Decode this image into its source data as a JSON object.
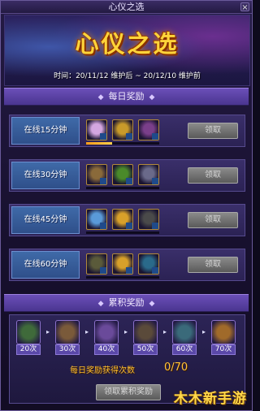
{
  "window": {
    "title": "心仪之选",
    "close_label": "×"
  },
  "banner": {
    "title": "心仪之选",
    "time": "时间：20/11/12 维护后 ~ 20/12/10 维护前"
  },
  "daily": {
    "header": "每日奖励",
    "header_ornament": "◆",
    "rows": [
      {
        "label": "在线15分钟",
        "button": "领取",
        "progress": 0.35,
        "items": [
          {
            "icon": "pink-crystal-icon",
            "color": "#d4a6e0"
          },
          {
            "icon": "gold-medal-icon",
            "color": "#c89a2a"
          },
          {
            "icon": "purple-chest-icon",
            "color": "#7a3f8a"
          }
        ]
      },
      {
        "label": "在线30分钟",
        "button": "领取",
        "progress": 0,
        "items": [
          {
            "icon": "wooden-box-icon",
            "color": "#8a6a3a"
          },
          {
            "icon": "green-ticket-icon",
            "color": "#4a8a2a"
          },
          {
            "icon": "silver-frame-icon",
            "color": "#6a6a8a"
          }
        ]
      },
      {
        "label": "在线45分钟",
        "button": "领取",
        "progress": 0,
        "items": [
          {
            "icon": "blue-crystal-icon",
            "color": "#5a9ad8"
          },
          {
            "icon": "gold-box-icon",
            "color": "#d8a02a"
          },
          {
            "icon": "dark-cube-icon",
            "color": "#4a4a4a"
          }
        ]
      },
      {
        "label": "在线60分钟",
        "button": "领取",
        "progress": 0,
        "items": [
          {
            "icon": "scroll-icon",
            "color": "#5a5a3a"
          },
          {
            "icon": "gold-chest-icon",
            "color": "#d8a02a"
          },
          {
            "icon": "blue-pet-icon",
            "color": "#2a6a8a"
          }
        ]
      }
    ]
  },
  "accumulated": {
    "header": "累积奖励",
    "header_ornament": "◆",
    "arrow": "▸",
    "tiers": [
      {
        "label": "20次",
        "icon": "green-chest-icon"
      },
      {
        "label": "30次",
        "icon": "brown-chest-icon"
      },
      {
        "label": "40次",
        "icon": "purple-chest-icon"
      },
      {
        "label": "50次",
        "icon": "dark-chest-icon"
      },
      {
        "label": "60次",
        "icon": "teal-chest-icon"
      },
      {
        "label": "70次",
        "icon": "orange-chest-icon"
      }
    ],
    "daily_count_label": "每日奖励获得次数",
    "daily_count": "0/70",
    "button": "领取累积奖励"
  },
  "watermark": "木木新手游"
}
